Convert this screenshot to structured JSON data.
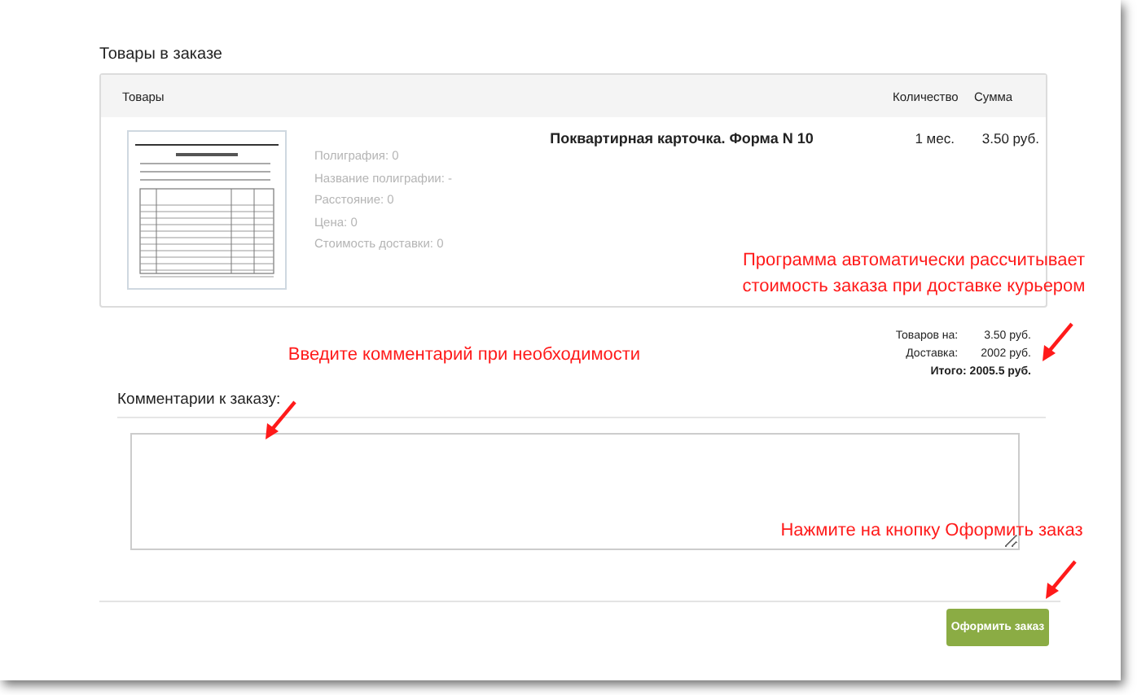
{
  "section_title": "Товары в заказе",
  "table": {
    "columns": [
      "Товары",
      "Количество",
      "Сумма"
    ],
    "rows": [
      {
        "details": [
          "Полиграфия: 0",
          "Название полиграфии: -",
          "Расстояние: 0",
          "Цена: 0",
          "Стоимость доставки: 0"
        ],
        "name": "Поквартирная карточка. Форма N 10",
        "quantity": "1 мес.",
        "sum": "3.50 руб."
      }
    ]
  },
  "totals": [
    {
      "label": "Товаров на:",
      "value": "3.50 руб.",
      "kind": "line"
    },
    {
      "label": "Доставка:",
      "value": "2002 руб.",
      "kind": "line"
    },
    {
      "label": "Итого:",
      "value": "2005.5 руб.",
      "kind": "total"
    }
  ],
  "comments": {
    "label": "Комментарии к заказу:"
  },
  "submit_button": "Оформить заказ",
  "annotations": [
    {
      "text": "Программа автоматически рассчитывает стоимость заказа при доставке курьером",
      "kind": "note"
    },
    {
      "text": "Введите комментарий при необходимости",
      "kind": "note"
    },
    {
      "text": "Нажмите на кнопку Оформить заказ",
      "kind": "note"
    }
  ]
}
